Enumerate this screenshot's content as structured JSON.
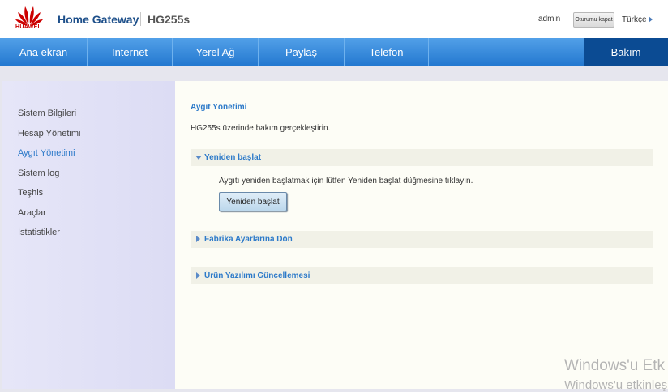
{
  "header": {
    "brand_name": "HUAWEI",
    "title": "Home Gateway",
    "model": "HG255s",
    "user": "admin",
    "logout_label": "Oturumu kapat",
    "language": "Türkçe"
  },
  "nav": {
    "items": [
      {
        "label": "Ana ekran"
      },
      {
        "label": "Internet"
      },
      {
        "label": "Yerel Ağ"
      },
      {
        "label": "Paylaş"
      },
      {
        "label": "Telefon"
      },
      {
        "label": "Bakım",
        "active": true
      }
    ]
  },
  "sidebar": {
    "items": [
      {
        "label": "Sistem Bilgileri"
      },
      {
        "label": "Hesap Yönetimi"
      },
      {
        "label": "Aygıt Yönetimi",
        "active": true
      },
      {
        "label": "Sistem log"
      },
      {
        "label": "Teşhis"
      },
      {
        "label": "Araçlar"
      },
      {
        "label": "İstatistikler"
      }
    ]
  },
  "main": {
    "section_title": "Aygıt Yönetimi",
    "description": "HG255s üzerinde bakım gerçekleştirin.",
    "restart": {
      "title": "Yeniden başlat",
      "instruction": "Aygıtı yeniden başlatmak için lütfen Yeniden başlat düğmesine tıklayın.",
      "button_label": "Yeniden başlat"
    },
    "factory_reset": {
      "title": "Fabrika Ayarlarına Dön"
    },
    "firmware_update": {
      "title": "Ürün Yazılımı Güncellemesi"
    }
  },
  "watermark": {
    "line1": "Windows'u Etk",
    "line2": "Windows'u etkinleş"
  },
  "colors": {
    "nav_blue": "#2277cf",
    "nav_active": "#0b4b93",
    "accent_blue": "#2d7ac9",
    "brand_red": "#cc0000"
  }
}
